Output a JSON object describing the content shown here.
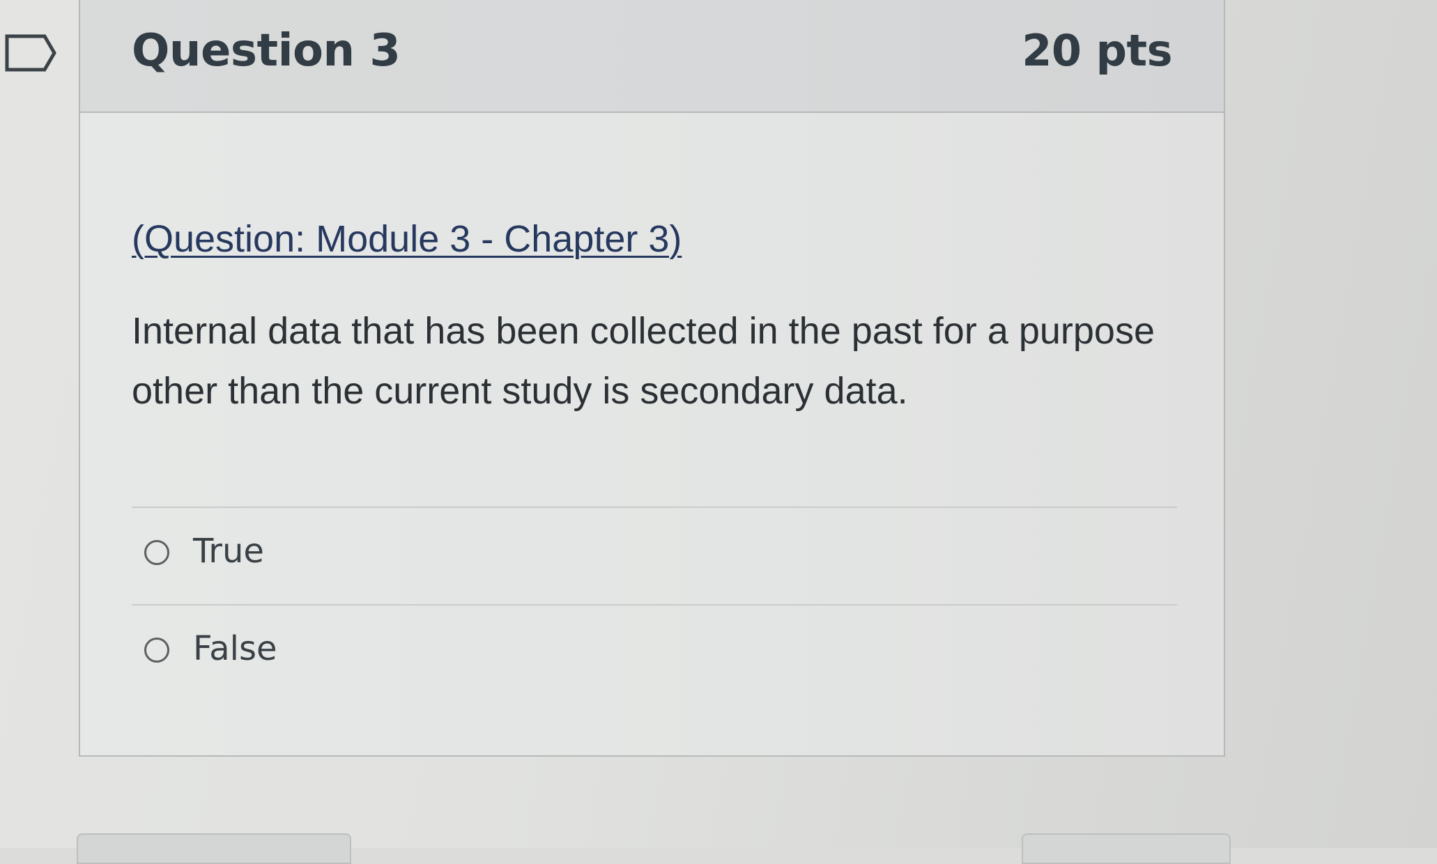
{
  "question": {
    "title": "Question 3",
    "points": "20 pts",
    "flag_icon": "flag-outline-icon",
    "module_link": "(Question: Module 3 - Chapter 3)",
    "text": "Internal data that has been collected in the past for a purpose other than the current study is secondary data.",
    "answers": [
      {
        "label": "True",
        "selected": false
      },
      {
        "label": "False",
        "selected": false
      }
    ]
  },
  "colors": {
    "link": "#26385e",
    "text": "#2b3034",
    "header_bg": "#d8dada"
  }
}
